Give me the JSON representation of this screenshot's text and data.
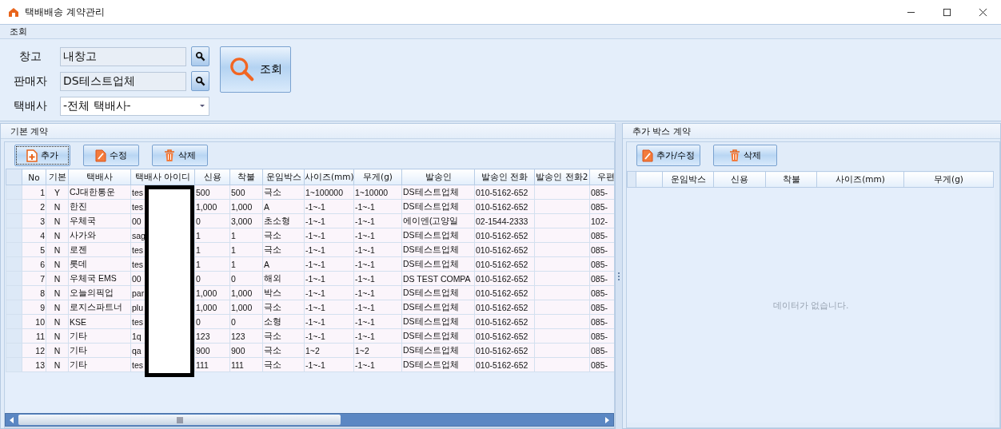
{
  "window": {
    "title": "택배배송 계약관리"
  },
  "menu": {
    "label": "조회"
  },
  "filters": [
    {
      "label": "창고",
      "value": "내창고",
      "kind": "lookup"
    },
    {
      "label": "판매자",
      "value": "DS테스트업체",
      "kind": "lookup"
    },
    {
      "label": "택배사",
      "value": "-전체 택배사-",
      "kind": "dropdown"
    }
  ],
  "search_button": {
    "label": "조회"
  },
  "basic_contract": {
    "title": "기본 계약",
    "buttons": [
      {
        "label": "추가",
        "kind": "add",
        "focused": true
      },
      {
        "label": "수정",
        "kind": "edit",
        "focused": false
      },
      {
        "label": "삭제",
        "kind": "delete",
        "focused": false
      }
    ],
    "columns": [
      "No",
      "기본",
      "택배사",
      "택배사 아이디",
      "신용",
      "착불",
      "운임박스",
      "사이즈(mm)",
      "무게(g)",
      "발송인",
      "발송인 전화",
      "발송인 전화2",
      "우편"
    ],
    "rows": [
      [
        "1",
        "Y",
        "CJ대한통운",
        "tes",
        "500",
        "500",
        "극소",
        "1~100000",
        "1~10000",
        "DS테스트업체",
        "010-5162-652",
        null,
        "085-"
      ],
      [
        "2",
        "N",
        "한진",
        "tes",
        "1,000",
        "1,000",
        "A",
        "-1~-1",
        "-1~-1",
        "DS테스트업체",
        "010-5162-652",
        null,
        "085-"
      ],
      [
        "3",
        "N",
        "우체국",
        "00",
        "0",
        "3,000",
        "초소형",
        "-1~-1",
        "-1~-1",
        "에이엔(고양일",
        "02-1544-2333",
        null,
        "102-"
      ],
      [
        "4",
        "N",
        "사가와",
        "sag",
        "1",
        "1",
        "극소",
        "-1~-1",
        "-1~-1",
        "DS테스트업체",
        "010-5162-652",
        null,
        "085-"
      ],
      [
        "5",
        "N",
        "로젠",
        "tes",
        "1",
        "1",
        "극소",
        "-1~-1",
        "-1~-1",
        "DS테스트업체",
        "010-5162-652",
        null,
        "085-"
      ],
      [
        "6",
        "N",
        "롯데",
        "tes",
        "1",
        "1",
        "A",
        "-1~-1",
        "-1~-1",
        "DS테스트업체",
        "010-5162-652",
        null,
        "085-"
      ],
      [
        "7",
        "N",
        "우체국 EMS",
        "00",
        "0",
        "0",
        "해외",
        "-1~-1",
        "-1~-1",
        "DS TEST COMPA",
        "010-5162-652",
        null,
        "085-"
      ],
      [
        "8",
        "N",
        "오늘의픽업",
        "par",
        "1,000",
        "1,000",
        "박스",
        "-1~-1",
        "-1~-1",
        "DS테스트업체",
        "010-5162-652",
        null,
        "085-"
      ],
      [
        "9",
        "N",
        "로지스파트너",
        "plu",
        "1,000",
        "1,000",
        "극소",
        "-1~-1",
        "-1~-1",
        "DS테스트업체",
        "010-5162-652",
        null,
        "085-"
      ],
      [
        "10",
        "N",
        "KSE",
        "tes",
        "0",
        "0",
        "소형",
        "-1~-1",
        "-1~-1",
        "DS테스트업체",
        "010-5162-652",
        null,
        "085-"
      ],
      [
        "11",
        "N",
        "기타",
        "1q",
        "123",
        "123",
        "극소",
        "-1~-1",
        "-1~-1",
        "DS테스트업체",
        "010-5162-652",
        null,
        "085-"
      ],
      [
        "12",
        "N",
        "기타",
        "qa",
        "900",
        "900",
        "극소",
        "1~2",
        "1~2",
        "DS테스트업체",
        "010-5162-652",
        null,
        "085-"
      ],
      [
        "13",
        "N",
        "기타",
        "tes",
        "111",
        "111",
        "극소",
        "-1~-1",
        "-1~-1",
        "DS테스트업체",
        "010-5162-652",
        null,
        "085-"
      ]
    ]
  },
  "extra_box_contract": {
    "title": "추가 박스 계약",
    "buttons": [
      {
        "label": "추가/수정",
        "kind": "edit",
        "focused": false
      },
      {
        "label": "삭제",
        "kind": "delete",
        "focused": false
      }
    ],
    "columns": [
      "운임박스",
      "신용",
      "착불",
      "사이즈(mm)",
      "무게(g)"
    ],
    "empty_message": "데이터가 없습니다."
  }
}
